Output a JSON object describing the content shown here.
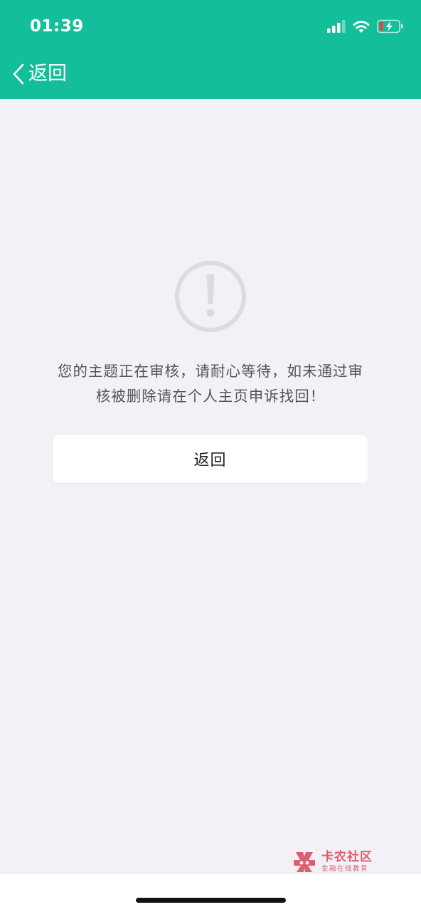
{
  "status_bar": {
    "time": "01:39",
    "icons": [
      "signal-icon",
      "wifi-icon",
      "battery-charging-icon"
    ]
  },
  "nav": {
    "back_label": "返回",
    "back_icon": "chevron-left-icon"
  },
  "notice": {
    "icon": "warning-icon",
    "message": "您的主题正在审核，请耐心等待，如未通过审核被删除请在个人主页申诉找回！",
    "button_label": "返回"
  },
  "watermark": {
    "title": "卡农社区",
    "subtitle": "金融在线教育"
  },
  "colors": {
    "header": "#13bf9a",
    "background": "#f3f1f5",
    "message_text": "#555555",
    "warning_icon": "#dcdcdc",
    "watermark": "#d9465a"
  }
}
